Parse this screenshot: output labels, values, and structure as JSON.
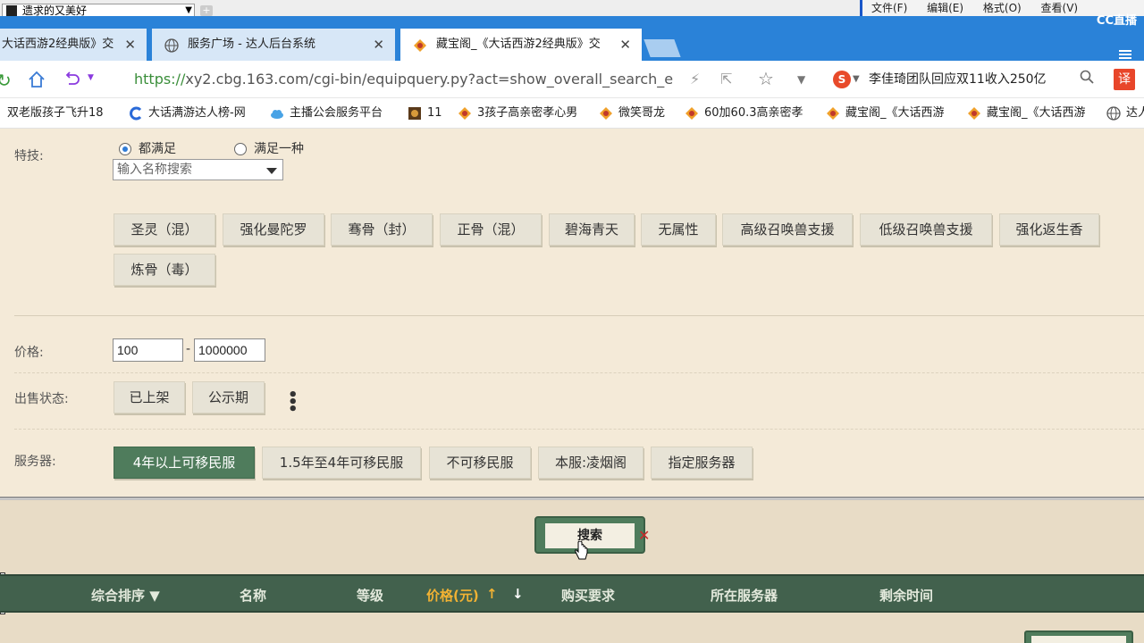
{
  "top_strip": {
    "window_title": "遗求的又美好",
    "menu": [
      "文件(F)",
      "编辑(E)",
      "格式(O)",
      "查看(V)"
    ],
    "cc_logo": "CC直播"
  },
  "tabs": [
    {
      "label": "大话西游2经典版》交",
      "state": "inactive"
    },
    {
      "label": "服务广场 - 达人后台系统",
      "state": "inactive"
    },
    {
      "label": "藏宝阁_《大话西游2经典版》交",
      "state": "active"
    }
  ],
  "address_bar": {
    "url_scheme": "https://",
    "url_rest": "xy2.cbg.163.com/cgi-bin/equipquery.py?act=show_overall_search_e",
    "news_text": "李佳琦团队回应双11收入250亿",
    "translate_label": "译"
  },
  "bookmarks": [
    {
      "label": "双老版孩子飞升18",
      "icon": "blank"
    },
    {
      "label": "大话满游达人榜-网",
      "icon": "c-icon"
    },
    {
      "label": "主播公会服务平台",
      "icon": "globe-blue"
    },
    {
      "label": "11",
      "icon": "game-icon"
    },
    {
      "label": "3孩子高亲密孝心男",
      "icon": "cbg-icon"
    },
    {
      "label": "微笑哥龙",
      "icon": "cbg-icon"
    },
    {
      "label": "60加60.3高亲密孝",
      "icon": "cbg-icon"
    },
    {
      "label": "藏宝阁_《大话西游",
      "icon": "cbg-icon"
    },
    {
      "label": "藏宝阁_《大话西游",
      "icon": "cbg-icon"
    },
    {
      "label": "达人",
      "icon": "globe-icon"
    }
  ],
  "skills": {
    "label": "特技:",
    "radio_all": "都满足",
    "radio_any": "满足一种",
    "search_placeholder": "输入名称搜索",
    "chips": [
      "圣灵（混）",
      "强化曼陀罗",
      "骞骨（封）",
      "正骨（混）",
      "碧海青天",
      "无属性",
      "高级召唤兽支援",
      "低级召唤兽支援",
      "强化返生香",
      "炼骨（毒）"
    ]
  },
  "price": {
    "label": "价格:",
    "min": "100",
    "max": "1000000",
    "separator": "-"
  },
  "sale_status": {
    "label": "出售状态:",
    "options": [
      "已上架",
      "公示期"
    ],
    "more": "⋮"
  },
  "server": {
    "label": "服务器:",
    "options": [
      "4年以上可移民服",
      "1.5年至4年可移民服",
      "不可移民服",
      "本服:凌烟阁",
      "指定服务器"
    ],
    "selected_index": 0
  },
  "search_button": "搜索",
  "results_header": {
    "sort": "综合排序 ▼",
    "name": "名称",
    "level": "等级",
    "price": "价格(元)",
    "price_up": "↑",
    "price_down": "↓",
    "requirement": "购买要求",
    "server": "所在服务器",
    "remaining": "剩余时间"
  },
  "colors": {
    "tab_bar": "#2a82d8",
    "page_bg": "#f4ead8",
    "green_accent": "#4f7c5c",
    "header_green": "#42614d",
    "price_orange": "#f2b233"
  }
}
